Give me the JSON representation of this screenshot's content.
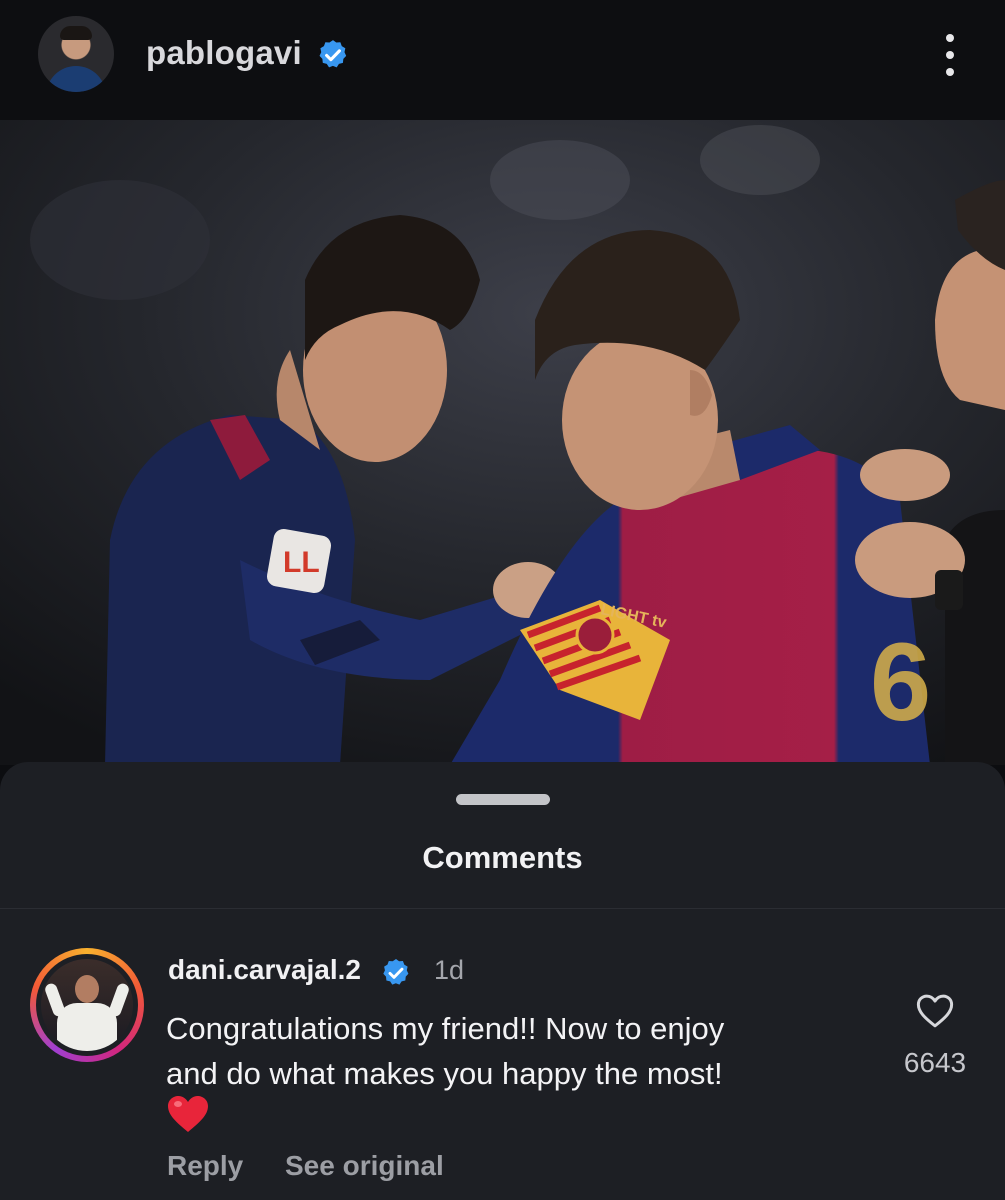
{
  "post": {
    "username": "pablogavi",
    "verified": true
  },
  "comments_sheet": {
    "title": "Comments",
    "comment": {
      "username": "dani.carvajal.2",
      "verified": true,
      "time": "1d",
      "text_line1": "Congratulations my friend!! Now to enjoy",
      "text_line2": "and do what makes you happy the most!",
      "emoji": "red-heart",
      "like_count": "6643",
      "reply_label": "Reply",
      "see_original_label": "See original"
    }
  },
  "colors": {
    "background": "#0c0d10",
    "sheet": "#1d1f24",
    "verified_blue": "#3897f0",
    "heart_red": "#e8253a",
    "barca_blue": "#1a2a6c",
    "barca_red": "#a3123a"
  }
}
